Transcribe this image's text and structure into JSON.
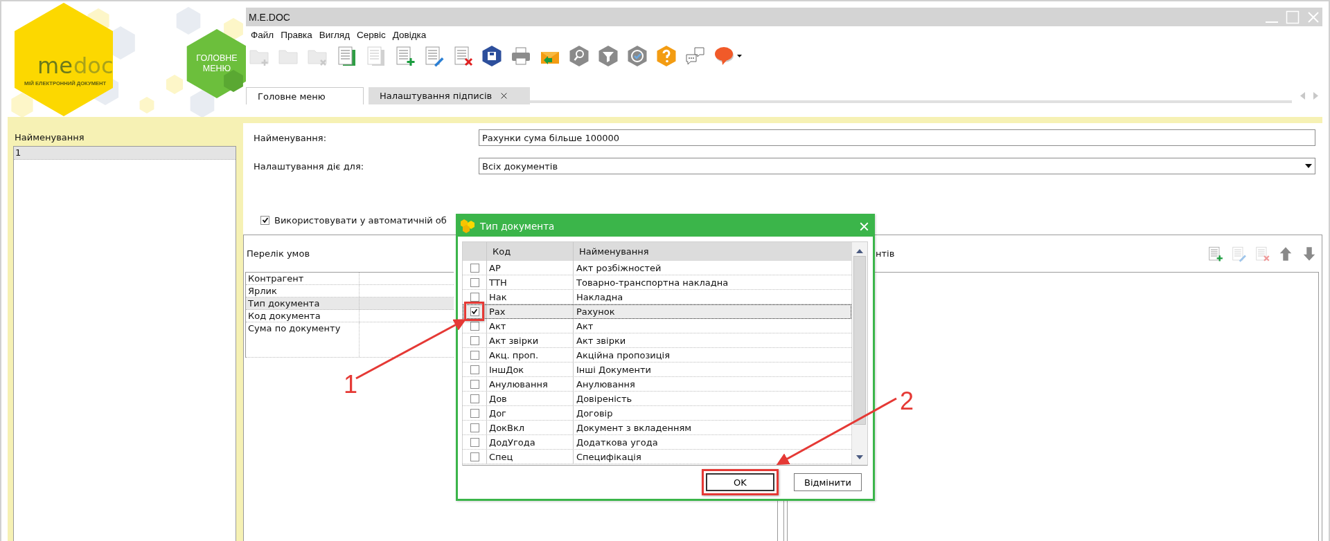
{
  "logo": {
    "brand_me": "me",
    "brand_doc": "doc",
    "tagline": "МІЙ ЕЛЕКТРОННИЙ ДОКУМЕНТ"
  },
  "main_menu_tile": {
    "label_lines": [
      "ГОЛОВНЕ",
      "МЕНЮ"
    ]
  },
  "window": {
    "title": "M.E.DOC"
  },
  "menu": [
    "Файл",
    "Правка",
    "Вигляд",
    "Сервіс",
    "Довідка"
  ],
  "toolbar": [
    {
      "kind": "folder_add",
      "disabled": true,
      "dropdown": false
    },
    {
      "kind": "folder",
      "disabled": true,
      "dropdown": false
    },
    {
      "kind": "folder_delete",
      "disabled": true,
      "dropdown": false
    },
    {
      "kind": "documents_green",
      "disabled": false,
      "dropdown": false
    },
    {
      "kind": "documents",
      "disabled": true,
      "dropdown": false
    },
    {
      "kind": "doc_add",
      "disabled": false,
      "dropdown": false
    },
    {
      "kind": "doc_edit",
      "disabled": false,
      "dropdown": false
    },
    {
      "kind": "doc_delete",
      "disabled": false,
      "dropdown": false
    },
    {
      "kind": "floppy",
      "disabled": false,
      "dropdown": false
    },
    {
      "kind": "printer",
      "disabled": false,
      "dropdown": false
    },
    {
      "kind": "envelope",
      "disabled": false,
      "dropdown": false
    },
    {
      "kind": "search",
      "disabled": false,
      "dropdown": false
    },
    {
      "kind": "funnel",
      "disabled": false,
      "dropdown": false
    },
    {
      "kind": "check",
      "disabled": false,
      "dropdown": false
    },
    {
      "kind": "help",
      "disabled": false,
      "dropdown": false
    },
    {
      "kind": "chat",
      "disabled": false,
      "dropdown": false
    },
    {
      "kind": "speech_bubble",
      "disabled": false,
      "dropdown": true
    }
  ],
  "tabs": [
    {
      "label": "Головне меню",
      "selected": false,
      "closable": false
    },
    {
      "label": "Налаштування підписів",
      "selected": true,
      "closable": true
    }
  ],
  "left_panel": {
    "header": "Найменування",
    "rows": [
      {
        "label": "1",
        "selected": true
      }
    ]
  },
  "form": {
    "fields": [
      {
        "kind": "text",
        "label": "Найменування:",
        "value": "Рахунки сума більше 100000"
      },
      {
        "kind": "select",
        "label": "Налаштування діє для:",
        "value": "Всіх документів"
      }
    ],
    "auto_checkbox": {
      "label": "Використовувати у автоматичній об",
      "checked": true
    }
  },
  "conditions": {
    "title": "Перелік умов",
    "rows": [
      {
        "label": "Контрагент",
        "selected": false
      },
      {
        "label": "Ярлик",
        "selected": false
      },
      {
        "label": "Тип документа",
        "selected": true
      },
      {
        "label": "Код документа",
        "selected": false
      },
      {
        "label": "Сума по документу",
        "selected": false
      }
    ]
  },
  "right_panel": {
    "title": "нтів",
    "toolbar": [
      {
        "kind": "doc_add",
        "disabled": false
      },
      {
        "kind": "doc_edit",
        "disabled": true
      },
      {
        "kind": "doc_delete",
        "disabled": true
      },
      {
        "kind": "arrow_up",
        "disabled": false
      },
      {
        "kind": "arrow_down",
        "disabled": false
      }
    ]
  },
  "dialog": {
    "title": "Тип документа",
    "columns": [
      "Код",
      "Найменування"
    ],
    "rows": [
      {
        "code": "АР",
        "name": "Акт розбіжностей",
        "checked": false,
        "selected": false,
        "annotated": false
      },
      {
        "code": "ТТН",
        "name": "Товарно-транспортна накладна",
        "checked": false,
        "selected": false,
        "annotated": false
      },
      {
        "code": "Нак",
        "name": "Накладна",
        "checked": false,
        "selected": false,
        "annotated": false
      },
      {
        "code": "Рах",
        "name": "Рахунок",
        "checked": true,
        "selected": true,
        "annotated": true
      },
      {
        "code": "Акт",
        "name": "Акт",
        "checked": false,
        "selected": false,
        "annotated": false
      },
      {
        "code": "Акт звірки",
        "name": "Акт звірки",
        "checked": false,
        "selected": false,
        "annotated": false
      },
      {
        "code": "Акц. проп.",
        "name": "Акційна пропозиція",
        "checked": false,
        "selected": false,
        "annotated": false
      },
      {
        "code": "ІншДок",
        "name": "Інші Документи",
        "checked": false,
        "selected": false,
        "annotated": false
      },
      {
        "code": "Анулювання",
        "name": "Анулювання",
        "checked": false,
        "selected": false,
        "annotated": false
      },
      {
        "code": "Дов",
        "name": "Довіреність",
        "checked": false,
        "selected": false,
        "annotated": false
      },
      {
        "code": "Дог",
        "name": "Договір",
        "checked": false,
        "selected": false,
        "annotated": false
      },
      {
        "code": "ДокВкл",
        "name": "Документ з вкладенням",
        "checked": false,
        "selected": false,
        "annotated": false
      },
      {
        "code": "ДодУгода",
        "name": "Додаткова угода",
        "checked": false,
        "selected": false,
        "annotated": false
      },
      {
        "code": "Спец",
        "name": "Специфікація",
        "checked": false,
        "selected": false,
        "annotated": false
      }
    ],
    "buttons": [
      {
        "label": "OK",
        "default": true,
        "annotated": true
      },
      {
        "label": "Відмінити",
        "default": false,
        "annotated": false
      }
    ]
  },
  "annotations": [
    {
      "label": "1"
    },
    {
      "label": "2"
    }
  ]
}
